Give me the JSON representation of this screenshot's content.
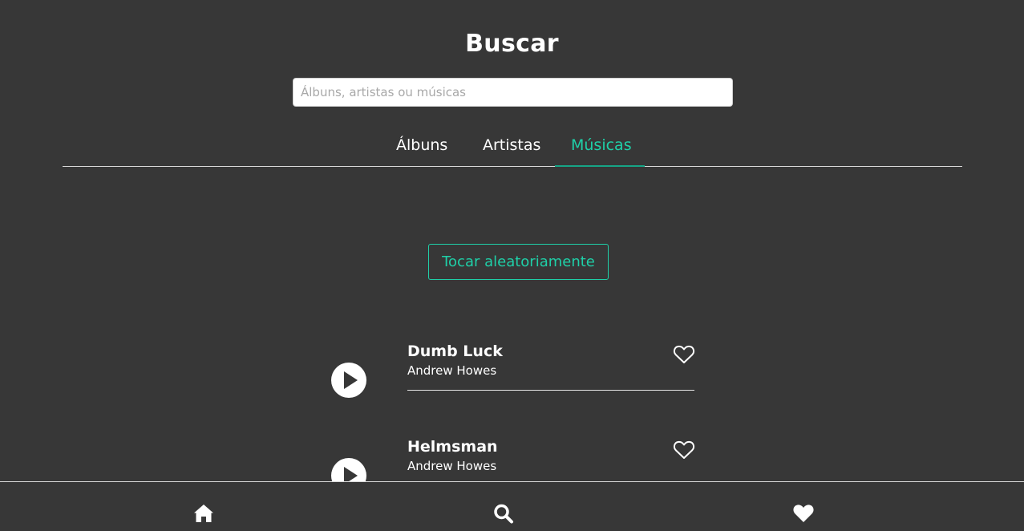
{
  "header": {
    "title": "Buscar"
  },
  "search": {
    "placeholder": "Álbuns, artistas ou músicas",
    "value": ""
  },
  "tabs": [
    {
      "label": "Álbuns",
      "active": false
    },
    {
      "label": "Artistas",
      "active": false
    },
    {
      "label": "Músicas",
      "active": true
    }
  ],
  "shuffle": {
    "label": "Tocar aleatoriamente"
  },
  "songs": [
    {
      "title": "Dumb Luck",
      "artist": "Andrew Howes",
      "icons": {
        "play": "play-icon",
        "favorite": "heart-outline-icon"
      }
    },
    {
      "title": "Helmsman",
      "artist": "Andrew Howes",
      "icons": {
        "play": "play-icon",
        "favorite": "heart-outline-icon"
      }
    }
  ],
  "bottom_nav": [
    {
      "icon": "home-icon"
    },
    {
      "icon": "search-icon"
    },
    {
      "icon": "heart-icon"
    }
  ],
  "colors": {
    "background": "#373737",
    "accent": "#1fd0a8",
    "text": "#ffffff"
  }
}
